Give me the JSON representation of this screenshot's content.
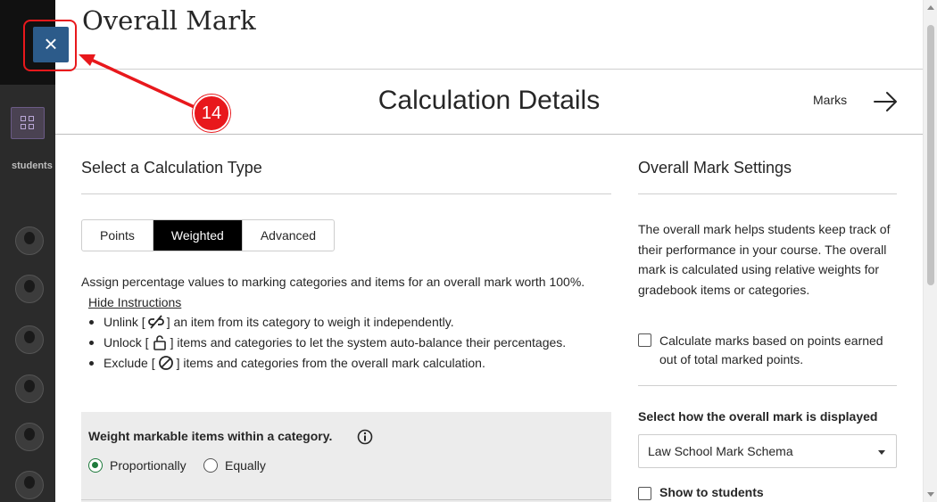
{
  "background": {
    "students_label": "students"
  },
  "panel": {
    "title": "Overall Mark",
    "calc_title": "Calculation Details",
    "marks_link": "Marks"
  },
  "left": {
    "heading": "Select a Calculation Type",
    "tabs": [
      {
        "label": "Points",
        "active": false
      },
      {
        "label": "Weighted",
        "active": true
      },
      {
        "label": "Advanced",
        "active": false
      }
    ],
    "description": "Assign percentage values to marking categories and items for an overall mark worth 100%.",
    "hide_instructions": "Hide Instructions",
    "bullets": {
      "unlink_pre": "Unlink [",
      "unlink_post": "] an item from its category to weigh it independently.",
      "unlock_pre": "Unlock [",
      "unlock_post": "] items and categories to let the system auto-balance their percentages.",
      "exclude_pre": "Exclude [",
      "exclude_post": "] items and categories from the overall mark calculation."
    },
    "weight_box": {
      "title": "Weight markable items within a category.",
      "option_proportionally": "Proportionally",
      "option_equally": "Equally",
      "selected": "Proportionally"
    }
  },
  "right": {
    "heading": "Overall Mark Settings",
    "description": "The overall mark helps students keep track of their performance in your course. The overall mark is calculated using relative weights for gradebook items or categories.",
    "checkbox_points": "Calculate marks based on points earned out of total marked points.",
    "select_label": "Select how the overall mark is displayed",
    "select_value": "Law School Mark Schema",
    "show_to_students": "Show to students"
  },
  "annotation": {
    "step_number": "14",
    "color": "#e8181c"
  },
  "colors": {
    "close_button": "#2c5b8a",
    "active_tab": "#000000",
    "radio_selected": "#1e7a3c"
  }
}
